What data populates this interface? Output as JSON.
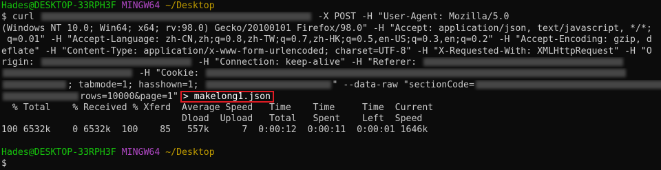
{
  "prompt": {
    "user_host": "Hades@DESKTOP-33RPH3F",
    "shell": "MINGW64",
    "cwd": "~/Desktop",
    "symbol": "$"
  },
  "command_lines": [
    {
      "pre": "curl ",
      "post": " -X POST -H \"User-Agent: Mozilla/5.0"
    },
    {
      "pre": "(Windows NT 10.0; Win64; x64; rv:98.0) Gecko/20100101 Firefox/98.0\" -H \"Accept: application/json, text/javascript, */*;"
    },
    {
      "pre": " q=0.01\" -H \"Accept-Language: zh-CN,zh;q=0.8,zh-TW;q=0.7,zh-HK;q=0.5,en-US;q=0.3,en;q=0.2\" -H \"Accept-Encoding: gzip, d"
    },
    {
      "pre": "eflate\" -H \"Content-Type: application/x-www-form-urlencoded; charset=UTF-8\" -H \"X-Requested-With: XMLHttpRequest\" -H \"O"
    },
    {
      "pre": "rigin: ",
      "post": " -H \"Connection: keep-alive\" -H \"Referer: "
    },
    {
      "pre": "",
      "post": " -H \"Cookie: "
    },
    {
      "pre": "",
      "post": "; tabmode=1; hasshown=1; ",
      "post2": "\" --data-raw \"sectionCode="
    },
    {
      "pre": "",
      "post": "rows=10000&page=1\""
    }
  ],
  "redirect": "> makelong1.json",
  "progress_header_1": "  % Total    % Received % Xferd  Average Speed   Time    Time     Time  Current",
  "progress_header_2": "                                 Dload  Upload   Total   Spent    Left  Speed",
  "progress_row": "100 6532k    0 6532k  100    85   557k      7  0:00:12  0:00:11  0:00:01 1646k",
  "colors": {
    "background": "#0c0c0c",
    "text": "#cccccc",
    "prompt_user": "#16c60c",
    "prompt_shell": "#b148c6",
    "prompt_path": "#c19c00",
    "highlight_box": "#e01c24"
  }
}
